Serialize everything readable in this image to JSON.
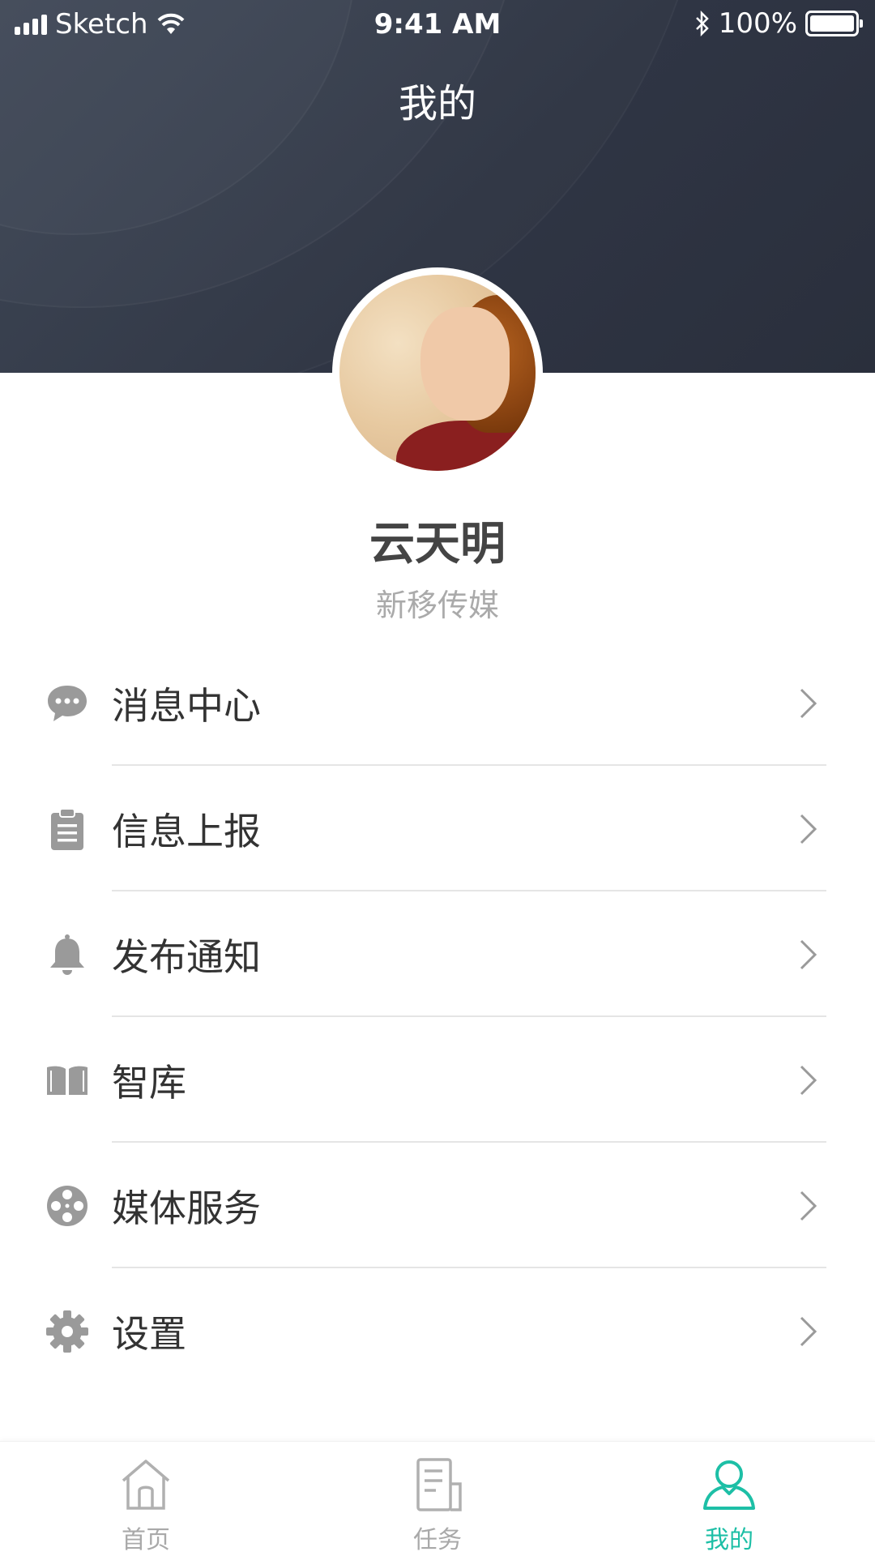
{
  "status_bar": {
    "carrier": "Sketch",
    "time": "9:41 AM",
    "battery": "100%"
  },
  "header": {
    "title": "我的"
  },
  "profile": {
    "name": "云天明",
    "organization": "新移传媒"
  },
  "menu": {
    "items": [
      {
        "label": "消息中心",
        "icon": "chat-bubble-icon"
      },
      {
        "label": "信息上报",
        "icon": "clipboard-icon"
      },
      {
        "label": "发布通知",
        "icon": "bell-icon"
      },
      {
        "label": "智库",
        "icon": "book-icon"
      },
      {
        "label": "媒体服务",
        "icon": "film-reel-icon"
      },
      {
        "label": "设置",
        "icon": "gear-icon"
      }
    ]
  },
  "tabbar": {
    "tabs": [
      {
        "label": "首页",
        "icon": "home-icon",
        "active": false
      },
      {
        "label": "任务",
        "icon": "task-document-icon",
        "active": false
      },
      {
        "label": "我的",
        "icon": "user-icon",
        "active": true
      }
    ]
  },
  "colors": {
    "header_bg": "#2f3544",
    "accent": "#1dbfa6",
    "icon_gray": "#9a9a9a",
    "text_primary": "#333333",
    "text_secondary": "#aaaaaa"
  }
}
